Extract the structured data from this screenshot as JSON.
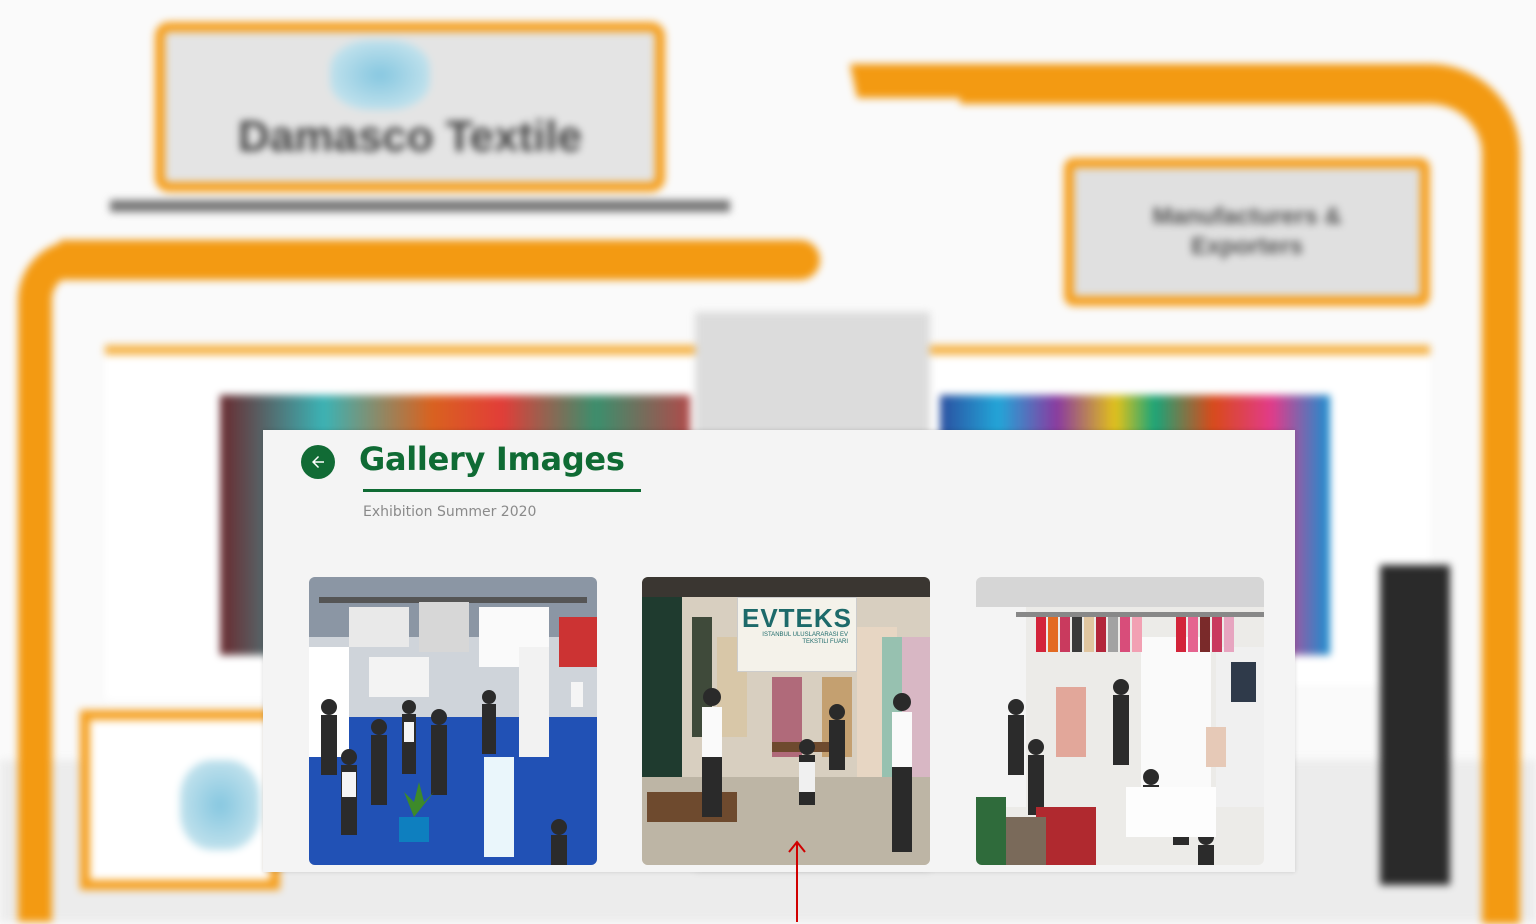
{
  "background": {
    "booth_sign_left": "Damasco Textile",
    "booth_sign_right": "Manufacturers & Exporters"
  },
  "gallery": {
    "title": "Gallery Images",
    "subtitle": "Exhibition Summer 2020",
    "back_icon": "arrow-left-icon",
    "accent_color": "#0f6b34",
    "images": [
      {
        "name": "exhibition-hall-blue-carpet"
      },
      {
        "name": "evteks-booth",
        "sign_text": "EVTEKS",
        "sign_subtext": "ISTANBUL ULUSLARARASI EV TEKSTILI FUARI"
      },
      {
        "name": "garment-display-booth"
      }
    ]
  },
  "annotation": {
    "color": "#d00000",
    "icon": "arrow-up-icon"
  }
}
